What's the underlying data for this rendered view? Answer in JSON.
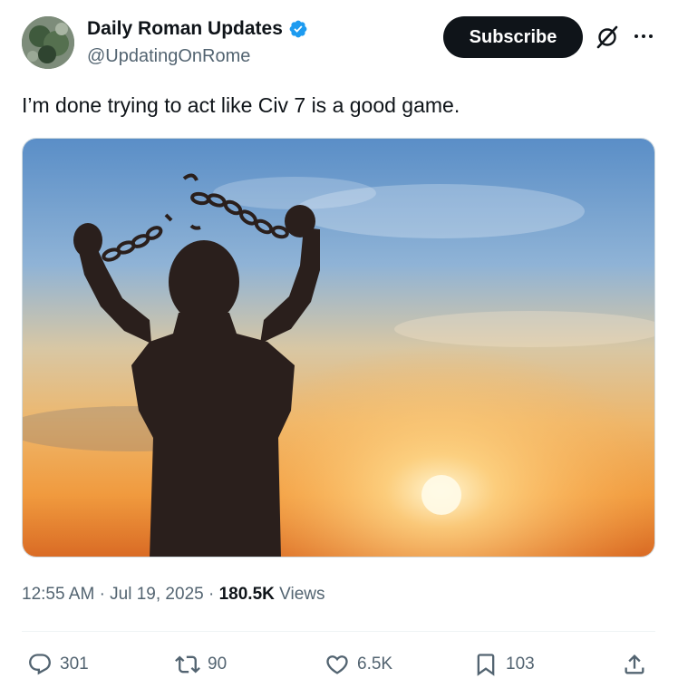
{
  "author": {
    "display_name": "Daily Roman Updates",
    "handle": "@UpdatingOnRome",
    "verified": true
  },
  "header": {
    "subscribe_label": "Subscribe",
    "icons": [
      "grok-icon",
      "more-options-icon"
    ]
  },
  "tweet": {
    "text": "I’m done trying to act like Civ 7 is a good game.",
    "time": "12:55 AM",
    "separator_1": "·",
    "date": "Jul 19, 2025",
    "separator_2": "·",
    "views_count": "180.5K",
    "views_label": "Views"
  },
  "actions": {
    "replies": "301",
    "reposts": "90",
    "likes": "6.5K",
    "bookmarks": "103"
  },
  "colors": {
    "text": "#0f1419",
    "secondary": "#536471",
    "verified": "#1d9bf0",
    "button_bg": "#0f1419"
  }
}
